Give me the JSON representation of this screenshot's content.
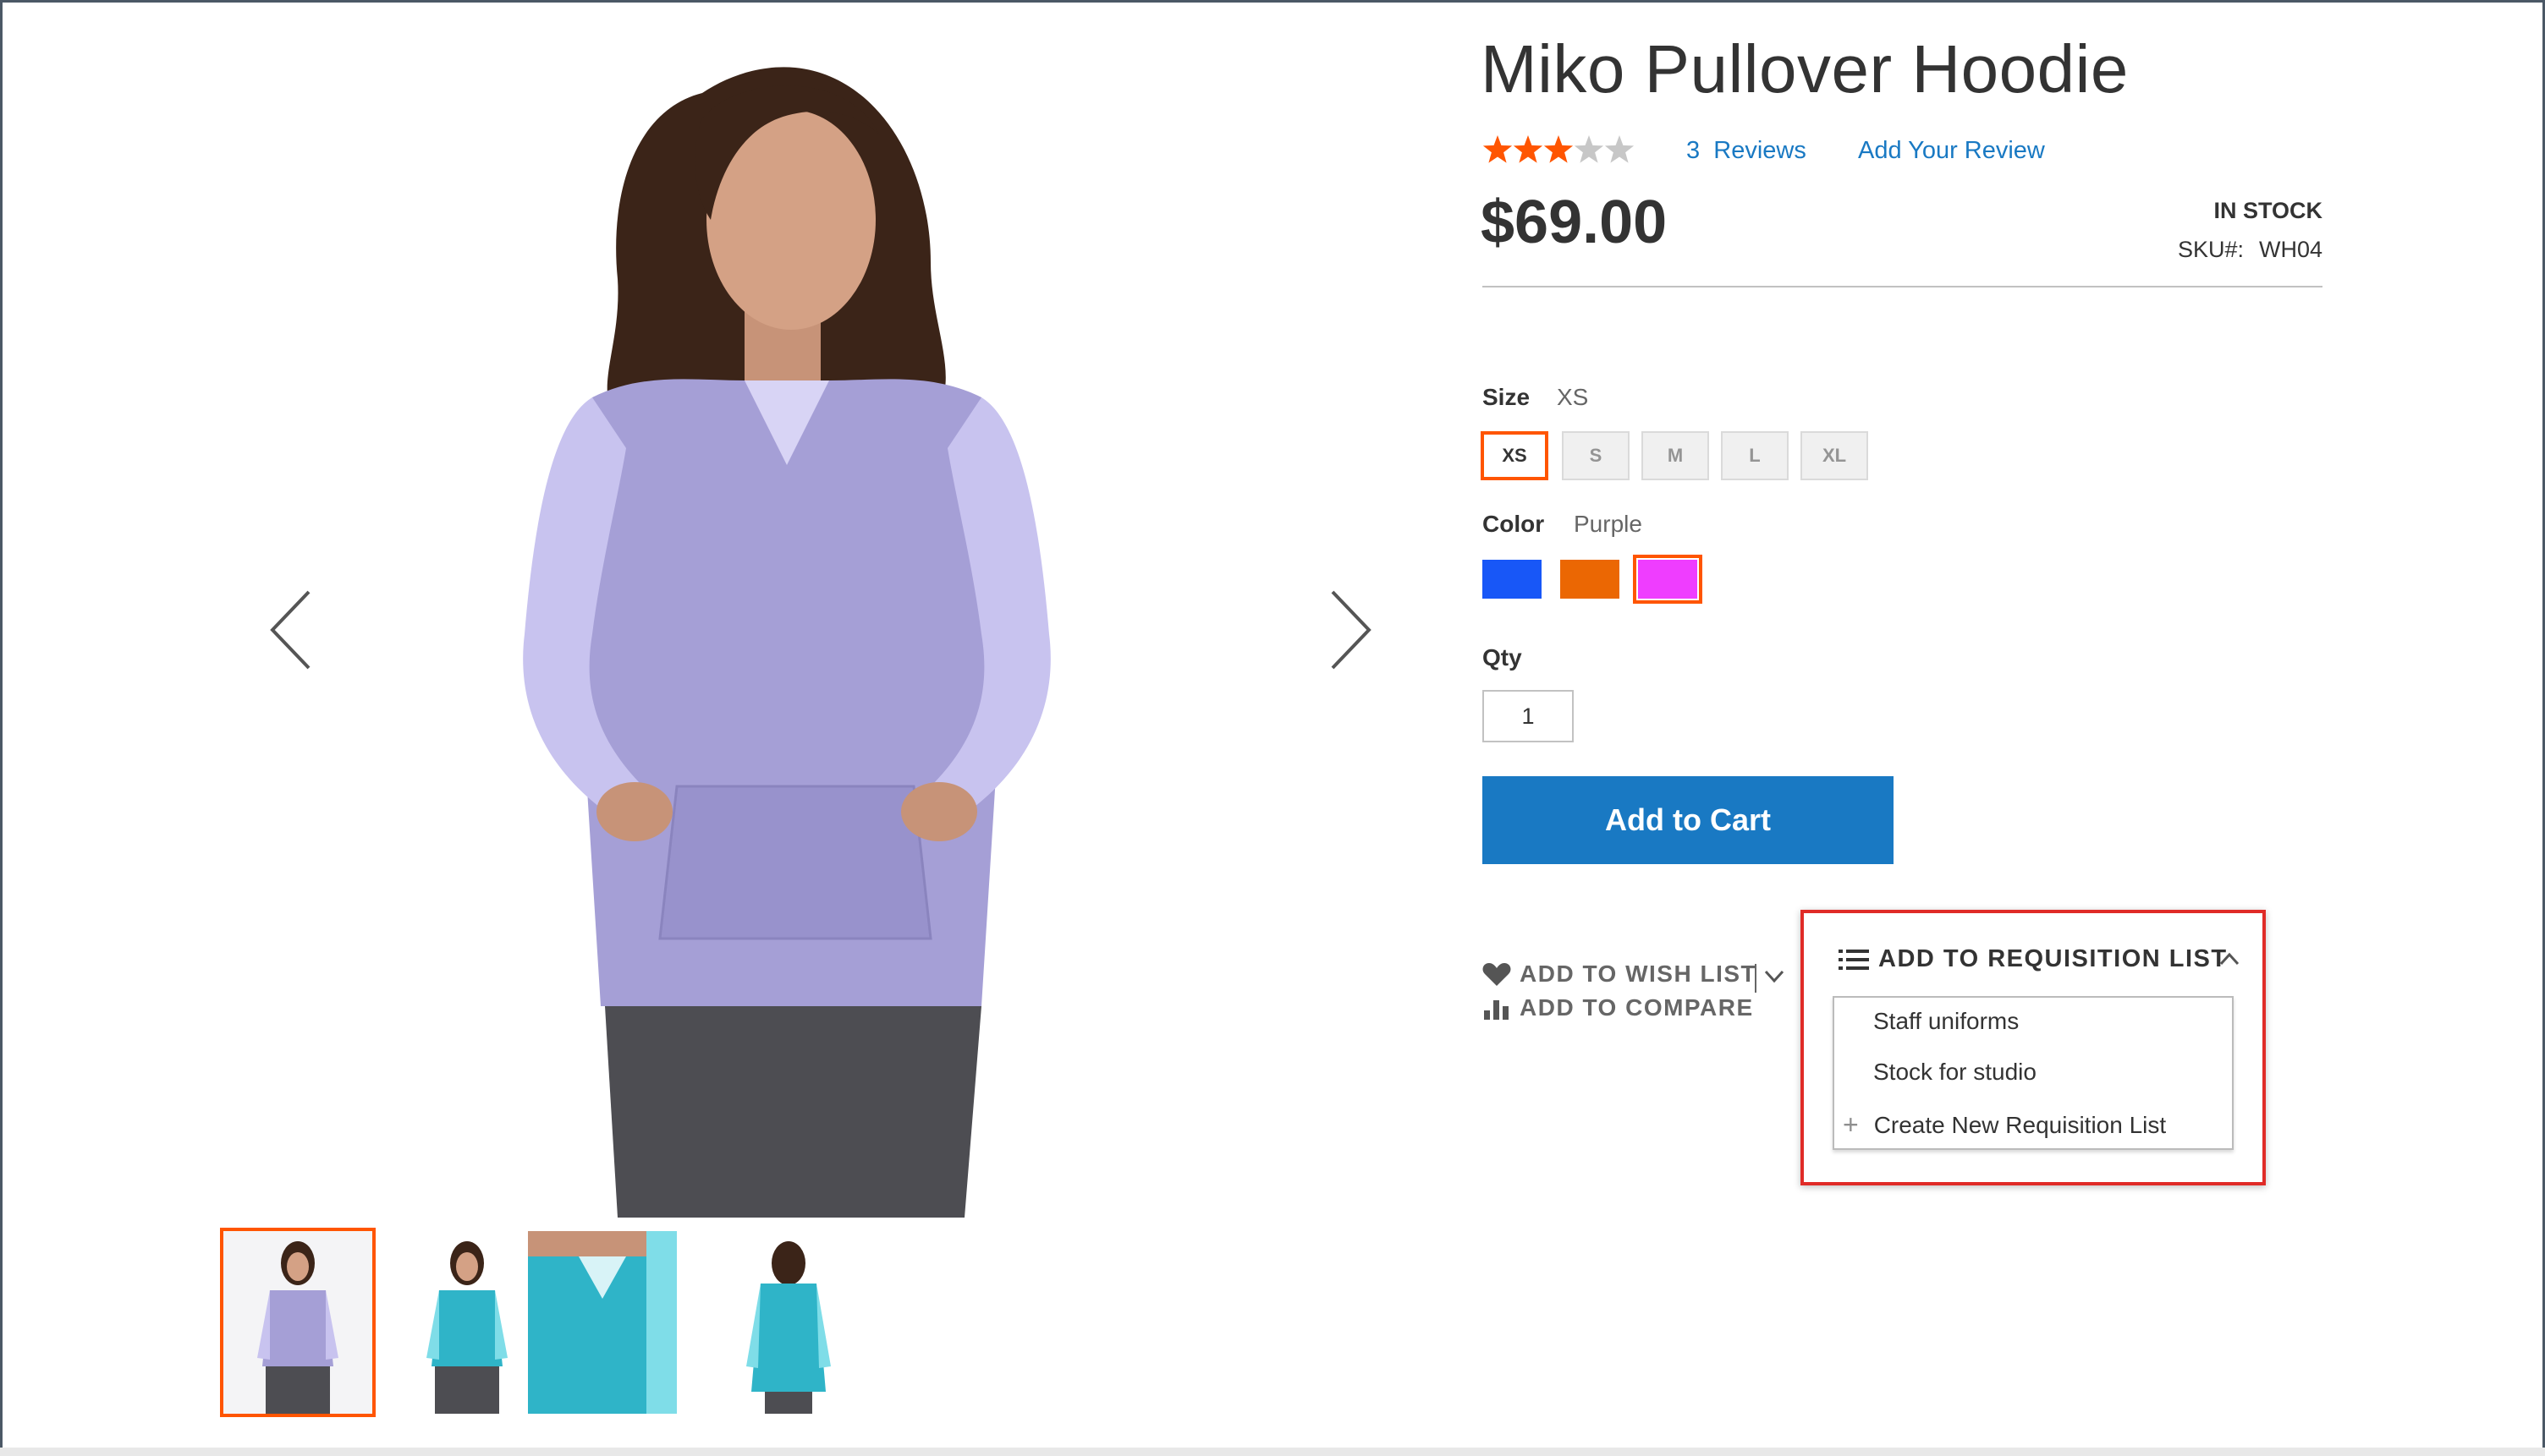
{
  "product": {
    "title": "Miko Pullover Hoodie",
    "rating_stars": 3,
    "rating_max": 5,
    "reviews_count": "3",
    "reviews_label": "Reviews",
    "add_review_label": "Add Your Review",
    "price": "$69.00",
    "stock_status": "In stock",
    "sku_label": "SKU#:",
    "sku": "WH04"
  },
  "options": {
    "size_label": "Size",
    "size_selected": "XS",
    "sizes": [
      "XS",
      "S",
      "M",
      "L",
      "XL"
    ],
    "color_label": "Color",
    "color_selected": "Purple",
    "colors": [
      {
        "name": "Blue",
        "hex": "#1857f7"
      },
      {
        "name": "Orange",
        "hex": "#eb6703"
      },
      {
        "name": "Purple",
        "hex": "#ef3dff"
      }
    ],
    "qty_label": "Qty",
    "qty_value": "1"
  },
  "actions": {
    "add_to_cart": "Add to Cart",
    "wish_list": "Add to Wish List",
    "compare": "Add to Compare"
  },
  "requisition": {
    "toggle_label": "Add to Requisition List",
    "lists": [
      "Staff uniforms",
      "Stock for studio"
    ],
    "create_label": "Create New Requisition List"
  },
  "colors": {
    "accent_link": "#1979c3",
    "button": "#1979c3",
    "selection": "#ff5501",
    "star_filled": "#ff5501",
    "star_empty": "#c7c7c7",
    "highlight": "#e02b27",
    "hoodie_lavender": "#a59fd6",
    "hoodie_sleeve": "#c8c3ef",
    "hoodie_teal": "#2fb4c8"
  },
  "icons": {
    "prev": "chevron-left-icon",
    "next": "chevron-right-icon",
    "wishlist": "heart-icon",
    "compare": "bar-chart-icon",
    "requisition": "list-icon",
    "collapse": "chevron-up-icon",
    "create": "plus-icon"
  },
  "gallery": {
    "thumbnails": [
      "front-lavender",
      "front-teal",
      "detail-teal",
      "back-teal"
    ],
    "active_index": 0
  }
}
